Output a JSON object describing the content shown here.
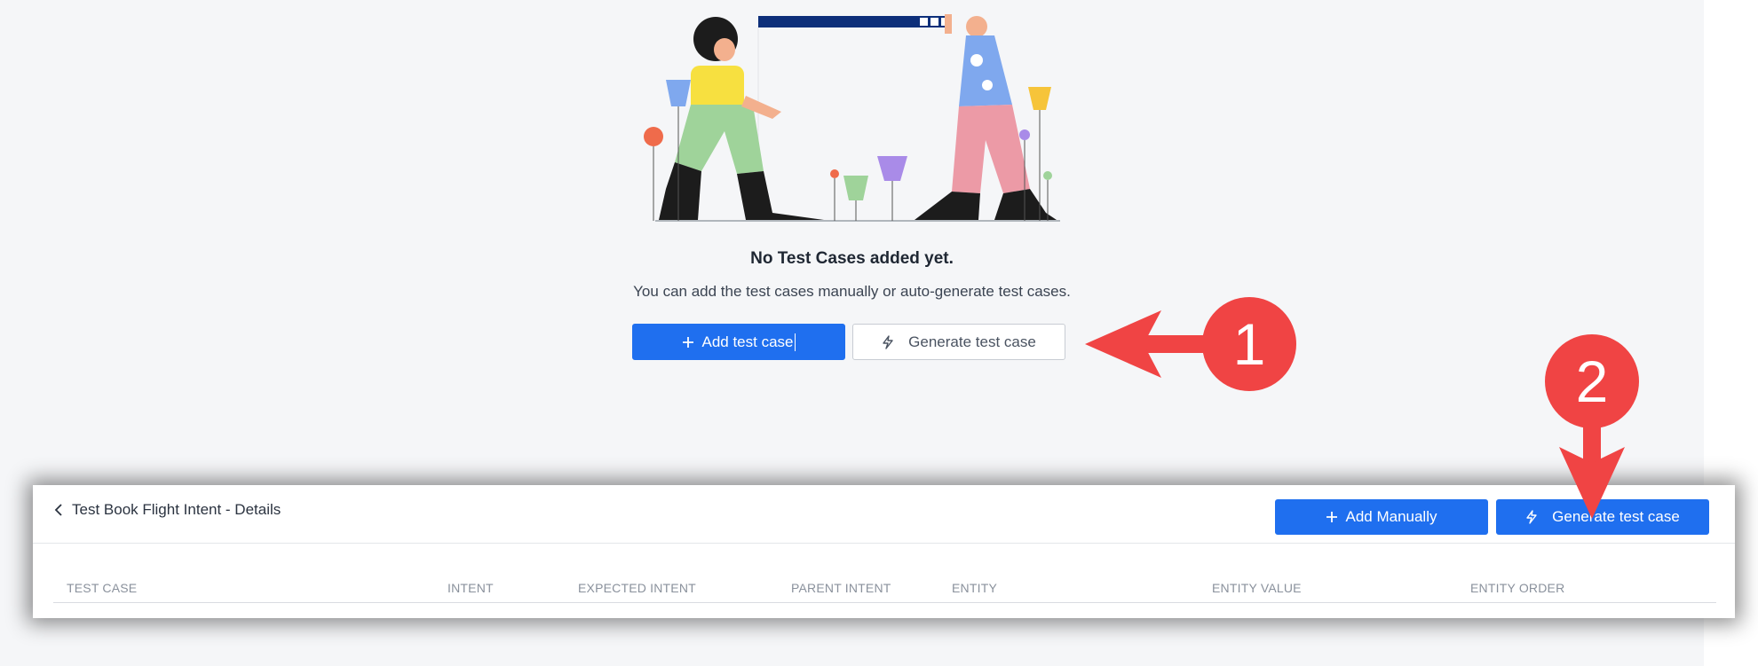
{
  "empty_state": {
    "title": "No Test Cases added yet.",
    "subtitle": "You can add the test cases manually or auto-generate test cases.",
    "add_button_label": "Add test case",
    "generate_button_label": "Generate test case"
  },
  "panel": {
    "back_title": "Test Book Flight Intent - Details",
    "add_manually_label": "Add Manually",
    "generate_label": "Generate test case",
    "columns": [
      "TEST CASE",
      "INTENT",
      "EXPECTED INTENT",
      "PARENT INTENT",
      "ENTITY",
      "ENTITY VALUE",
      "ENTITY ORDER"
    ]
  },
  "annotations": {
    "marker_1": "1",
    "marker_2": "2",
    "color": "#f04444"
  },
  "icons": {
    "plus": "plus-icon",
    "bolt": "lightning-icon",
    "back": "chevron-left-icon"
  },
  "colors": {
    "primary": "#1f6fef",
    "background": "#f5f6f8"
  }
}
